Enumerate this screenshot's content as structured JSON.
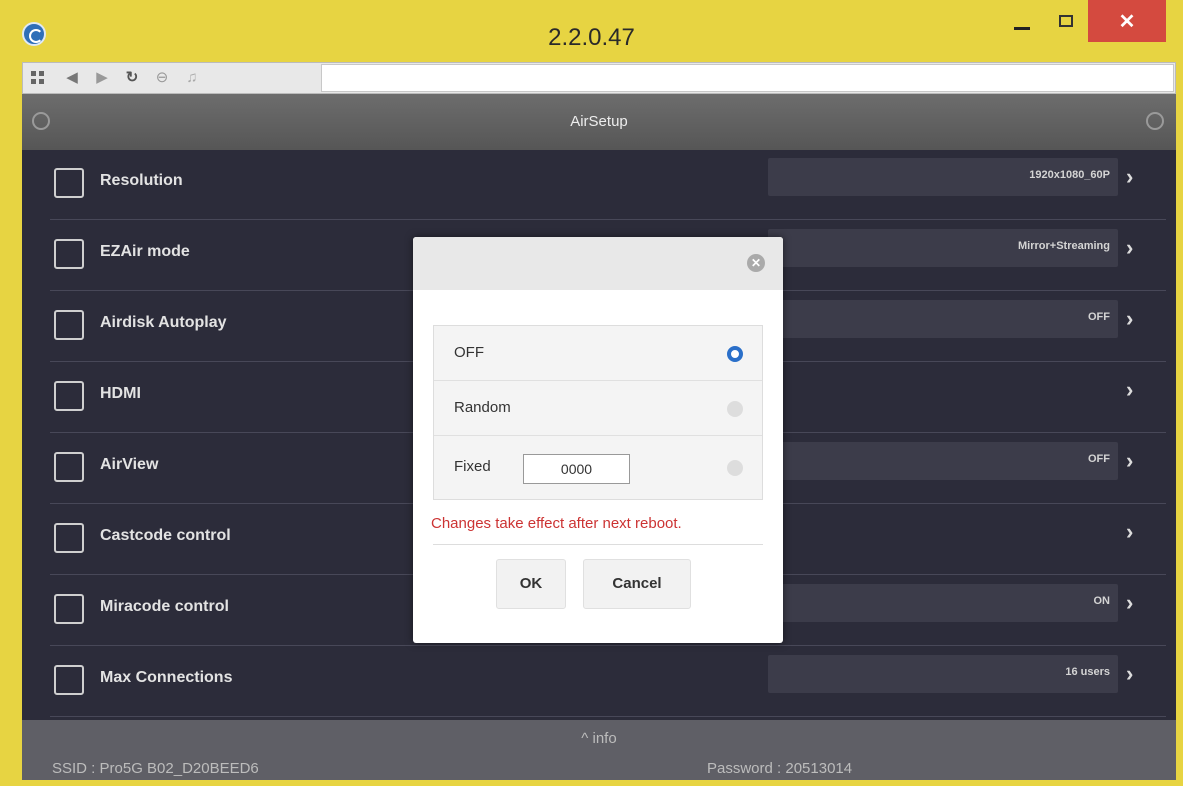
{
  "window": {
    "title": "2.2.0.47",
    "close_glyph": "✕",
    "url": ""
  },
  "toolbar": {
    "icons": [
      "apps-grid-icon",
      "back-arrow-icon",
      "forward-arrow-icon",
      "reload-icon",
      "stop-icon",
      "music-icon"
    ]
  },
  "header": {
    "title": "AirSetup"
  },
  "settings": [
    {
      "label": "Resolution",
      "value": "1920x1080_60P",
      "icon": "resolution-icon"
    },
    {
      "label": "EZAir mode",
      "value": "Mirror+Streaming",
      "icon": "wifi-screen-icon"
    },
    {
      "label": "Airdisk Autoplay",
      "value": "OFF",
      "icon": "autoplay-icon"
    },
    {
      "label": "HDMI",
      "value": "",
      "icon": "hdmi-icon"
    },
    {
      "label": "AirView",
      "value": "OFF",
      "icon": "airview-icon"
    },
    {
      "label": "Castcode control",
      "value": "",
      "icon": "cast-icon"
    },
    {
      "label": "Miracode control",
      "value": "ON",
      "icon": "miracast-icon"
    },
    {
      "label": "Max Connections",
      "value": "16 users",
      "icon": "connections-icon"
    }
  ],
  "footer": {
    "info": "^ info",
    "ssid": "SSID : Pro5G B02_D20BEED6",
    "password": "Password : 20513014"
  },
  "dialog": {
    "options": [
      {
        "label": "OFF",
        "selected": true
      },
      {
        "label": "Random",
        "selected": false
      },
      {
        "label": "Fixed",
        "selected": false,
        "input_value": "0000"
      }
    ],
    "note": "Changes take effect after next reboot.",
    "ok_label": "OK",
    "cancel_label": "Cancel"
  },
  "colors": {
    "window_frame": "#e7d442",
    "list_bg": "#2c2c3a",
    "accent": "#2a6fc9",
    "warning": "#cc3333",
    "close_button": "#d44a3f"
  }
}
